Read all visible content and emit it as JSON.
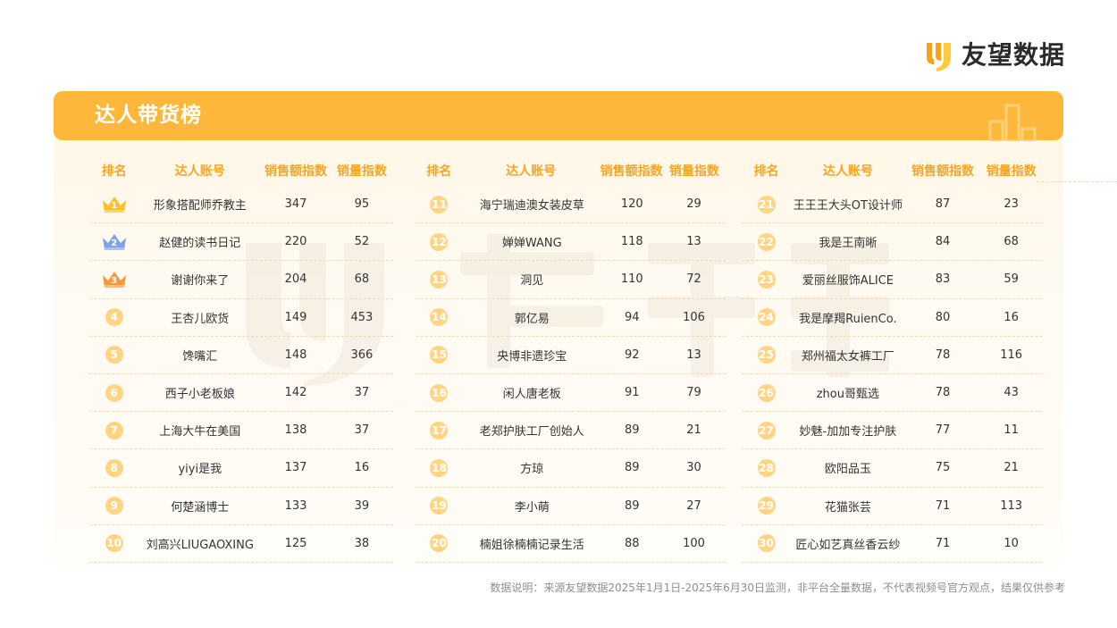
{
  "brand": {
    "name": "友望数据"
  },
  "card": {
    "title": "达人带货榜"
  },
  "headers": {
    "rank": "排名",
    "account": "达人账号",
    "sales_amount": "销售额指数",
    "sales_volume": "销量指数"
  },
  "columns": [
    {
      "rows": [
        {
          "rank": "1",
          "account": "形象搭配师乔教主",
          "amount": "347",
          "volume": "95"
        },
        {
          "rank": "2",
          "account": "赵健的读书日记",
          "amount": "220",
          "volume": "52"
        },
        {
          "rank": "3",
          "account": "谢谢你来了",
          "amount": "204",
          "volume": "68"
        },
        {
          "rank": "4",
          "account": "王杏儿欧货",
          "amount": "149",
          "volume": "453"
        },
        {
          "rank": "5",
          "account": "馋嘴汇",
          "amount": "148",
          "volume": "366"
        },
        {
          "rank": "6",
          "account": "西子小老板娘",
          "amount": "142",
          "volume": "37"
        },
        {
          "rank": "7",
          "account": "上海大牛在美国",
          "amount": "138",
          "volume": "37"
        },
        {
          "rank": "8",
          "account": "yiyi是我",
          "amount": "137",
          "volume": "16"
        },
        {
          "rank": "9",
          "account": "何楚涵博士",
          "amount": "133",
          "volume": "39"
        },
        {
          "rank": "10",
          "account": "刘高兴LIUGAOXING",
          "amount": "125",
          "volume": "38"
        }
      ]
    },
    {
      "rows": [
        {
          "rank": "11",
          "account": "海宁瑞迪澳女装皮草",
          "amount": "120",
          "volume": "29"
        },
        {
          "rank": "12",
          "account": "婵婵WANG",
          "amount": "118",
          "volume": "13"
        },
        {
          "rank": "13",
          "account": "洞见",
          "amount": "110",
          "volume": "72"
        },
        {
          "rank": "14",
          "account": "郭亿易",
          "amount": "94",
          "volume": "106"
        },
        {
          "rank": "15",
          "account": "央博非遗珍宝",
          "amount": "92",
          "volume": "13"
        },
        {
          "rank": "16",
          "account": "闲人唐老板",
          "amount": "91",
          "volume": "79"
        },
        {
          "rank": "17",
          "account": "老郑护肤工厂创始人",
          "amount": "89",
          "volume": "21"
        },
        {
          "rank": "18",
          "account": "方琼",
          "amount": "89",
          "volume": "30"
        },
        {
          "rank": "19",
          "account": "李小萌",
          "amount": "89",
          "volume": "27"
        },
        {
          "rank": "20",
          "account": "楠姐徐楠楠记录生活",
          "amount": "88",
          "volume": "100"
        }
      ]
    },
    {
      "rows": [
        {
          "rank": "21",
          "account": "王王王大头OT设计师",
          "amount": "87",
          "volume": "23"
        },
        {
          "rank": "22",
          "account": "我是王南晰",
          "amount": "84",
          "volume": "68"
        },
        {
          "rank": "23",
          "account": "爱丽丝服饰ALICE",
          "amount": "83",
          "volume": "59"
        },
        {
          "rank": "24",
          "account": "我是摩羯RuienCo.",
          "amount": "80",
          "volume": "16"
        },
        {
          "rank": "25",
          "account": "郑州福太女裤工厂",
          "amount": "78",
          "volume": "116"
        },
        {
          "rank": "26",
          "account": "zhou哥甄选",
          "amount": "78",
          "volume": "43"
        },
        {
          "rank": "27",
          "account": "妙魅-加加专注护肤",
          "amount": "77",
          "volume": "11"
        },
        {
          "rank": "28",
          "account": "欧阳品玉",
          "amount": "75",
          "volume": "21"
        },
        {
          "rank": "29",
          "account": "花猫张芸",
          "amount": "71",
          "volume": "113"
        },
        {
          "rank": "30",
          "account": "匠心如艺真丝香云纱",
          "amount": "71",
          "volume": "10"
        }
      ]
    }
  ],
  "footnote": "数据说明：来源友望数据2025年1月1日-2025年6月30日监测，非平台全量数据，不代表视频号官方观点，结果仅供参考",
  "colors": {
    "accent": "#fdb73b",
    "header_text": "#f5a623",
    "gold": "#fcc02a",
    "silver": "#7fa3e6",
    "bronze": "#f59a3c",
    "badge": "#ffd584"
  },
  "icons": {
    "rank_1_2_3": "crown-icon",
    "rank_other": "circle-badge"
  }
}
